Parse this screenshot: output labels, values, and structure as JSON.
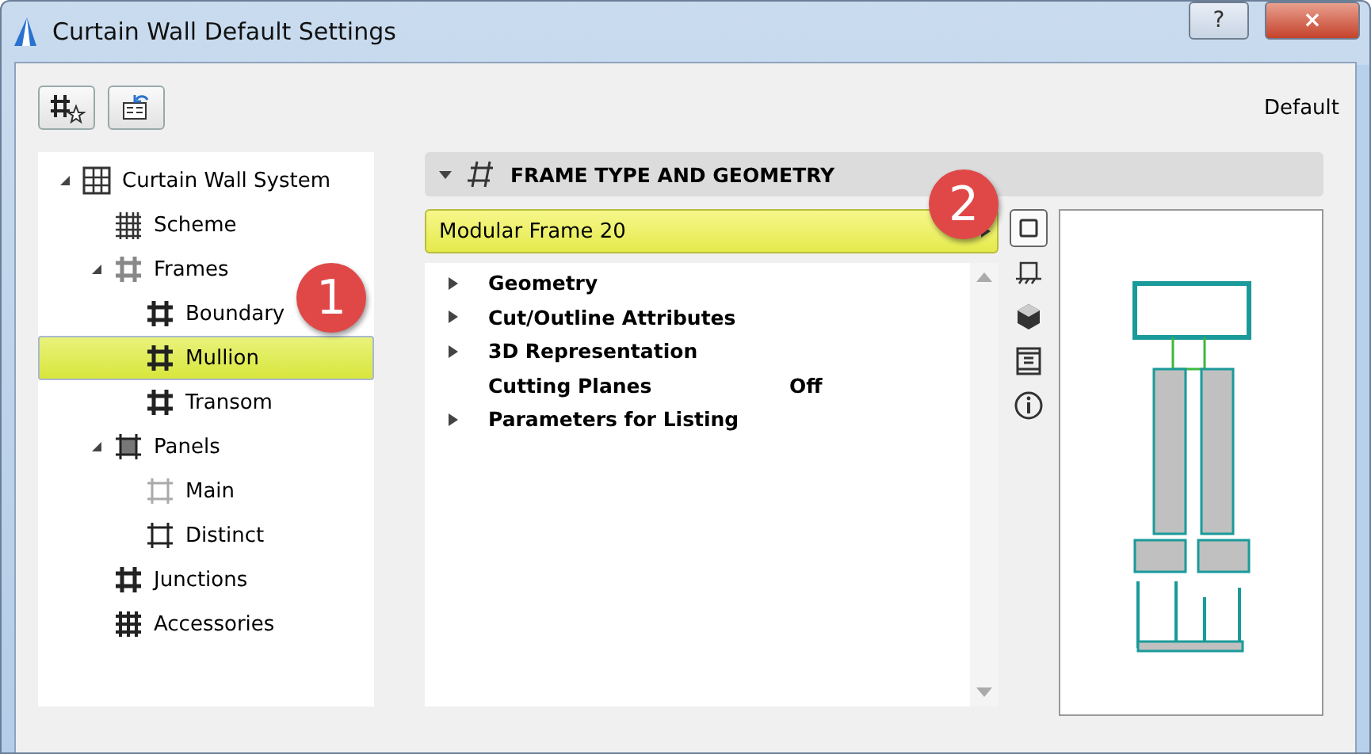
{
  "window": {
    "title": "Curtain Wall Default Settings",
    "help": "?",
    "close": "×"
  },
  "toolbar": {
    "status": "Default"
  },
  "tree": [
    {
      "label": "Curtain Wall System",
      "kind": "system",
      "expanded": true,
      "selected": false,
      "children": [
        {
          "label": "Scheme",
          "kind": "scheme",
          "selected": false
        },
        {
          "label": "Frames",
          "kind": "frames",
          "expanded": true,
          "selected": false,
          "children": [
            {
              "label": "Boundary",
              "kind": "frame",
              "selected": false
            },
            {
              "label": "Mullion",
              "kind": "frame",
              "selected": true
            },
            {
              "label": "Transom",
              "kind": "frame",
              "selected": false
            }
          ]
        },
        {
          "label": "Panels",
          "kind": "panels",
          "expanded": true,
          "selected": false,
          "children": [
            {
              "label": "Main",
              "kind": "panel-faint",
              "selected": false
            },
            {
              "label": "Distinct",
              "kind": "panel",
              "selected": false
            }
          ]
        },
        {
          "label": "Junctions",
          "kind": "frame",
          "selected": false
        },
        {
          "label": "Accessories",
          "kind": "accessories",
          "selected": false
        }
      ]
    }
  ],
  "panel": {
    "title": "FRAME TYPE AND GEOMETRY",
    "expanded": true,
    "selector": "Modular Frame 20",
    "properties": [
      {
        "label": "Geometry",
        "expandable": true
      },
      {
        "label": "Cut/Outline Attributes",
        "expandable": true
      },
      {
        "label": "3D Representation",
        "expandable": true
      },
      {
        "label": "Cutting Planes",
        "expandable": false,
        "value": "Off"
      },
      {
        "label": "Parameters for Listing",
        "expandable": true
      }
    ],
    "views": [
      {
        "kind": "plan",
        "selected": true
      },
      {
        "kind": "section",
        "selected": false
      },
      {
        "kind": "cube",
        "selected": false
      },
      {
        "kind": "listing",
        "selected": false
      },
      {
        "kind": "info",
        "selected": false
      }
    ]
  },
  "callouts": [
    {
      "text": "1"
    },
    {
      "text": "2"
    }
  ]
}
